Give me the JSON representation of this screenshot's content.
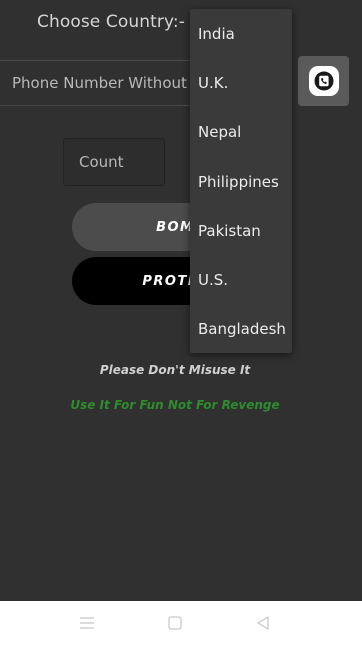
{
  "country": {
    "label": "Choose Country:-"
  },
  "phone": {
    "placeholder": "Phone Number Without Country Code"
  },
  "count": {
    "placeholder": "Count"
  },
  "buttons": {
    "bomb": "BOMB",
    "protect": "PROTECT"
  },
  "messages": {
    "warning": "Please Don't Misuse It",
    "fun": "Use It For Fun Not For Revenge"
  },
  "dropdown": {
    "options": [
      "India",
      "U.K.",
      "Nepal",
      "Philippines",
      "Pakistan",
      "U.S.",
      "Bangladesh"
    ]
  },
  "colors": {
    "background": "#303030",
    "fun_text": "#2e8b2e",
    "bomb_button": "#4c4c4c",
    "protect_button": "#000000"
  },
  "icons": {
    "contact": "contact-phone-icon",
    "nav_menu": "menu-icon",
    "nav_home": "home-square-icon",
    "nav_back": "back-triangle-icon"
  }
}
